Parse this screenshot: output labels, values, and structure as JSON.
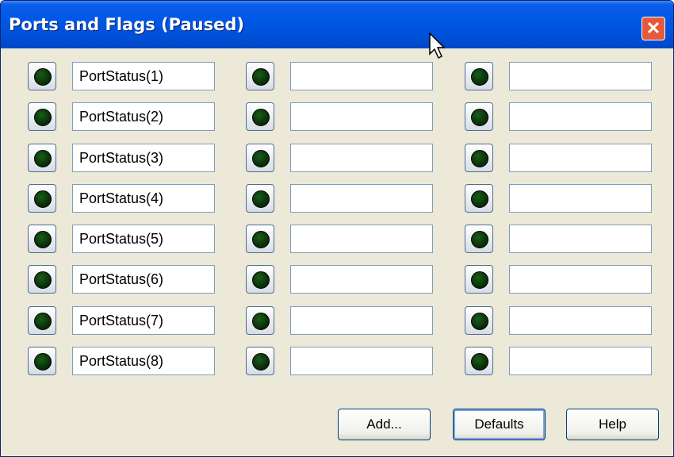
{
  "window": {
    "title": "Ports and Flags (Paused)",
    "close_glyph": "✕"
  },
  "columns": [
    [
      "PortStatus(1)",
      "PortStatus(2)",
      "PortStatus(3)",
      "PortStatus(4)",
      "PortStatus(5)",
      "PortStatus(6)",
      "PortStatus(7)",
      "PortStatus(8)"
    ],
    [
      "",
      "",
      "",
      "",
      "",
      "",
      "",
      ""
    ],
    [
      "",
      "",
      "",
      "",
      "",
      "",
      "",
      ""
    ]
  ],
  "buttons": {
    "add": "Add...",
    "defaults": "Defaults",
    "help": "Help"
  },
  "colors": {
    "titlebar": "#0058e6",
    "client": "#ece9d8",
    "led_off": "#062a06",
    "close": "#e55a3a"
  }
}
